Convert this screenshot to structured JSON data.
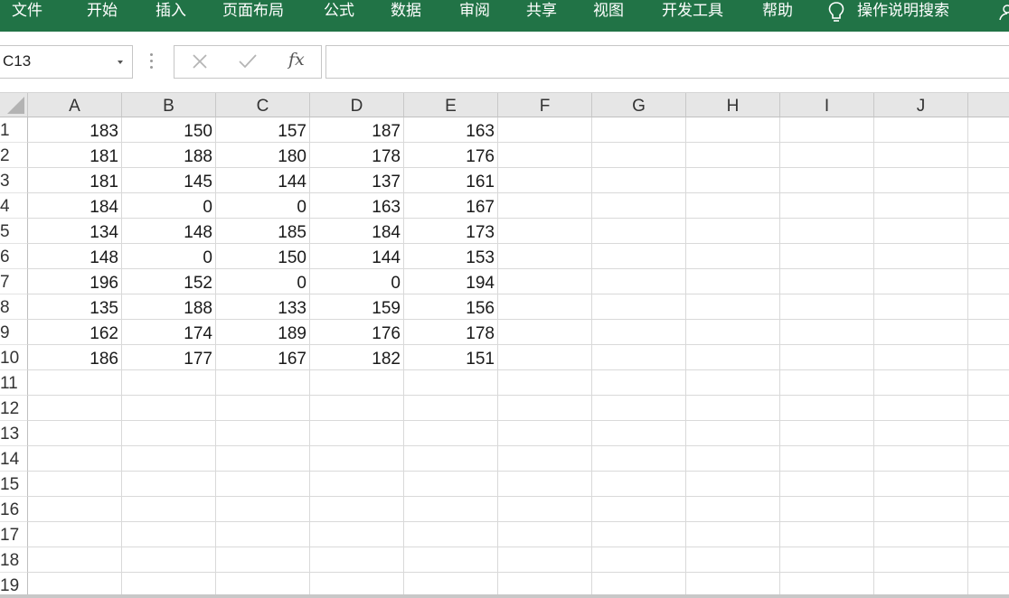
{
  "ribbon": {
    "tabs": [
      "文件",
      "开始",
      "插入",
      "页面布局",
      "公式",
      "数据",
      "审阅",
      "共享",
      "视图",
      "开发工具",
      "帮助"
    ],
    "search_label": "操作说明搜索",
    "icons": [
      "lightbulb-icon",
      "person-icon"
    ]
  },
  "formula_bar": {
    "name_box": "C13",
    "formula": "",
    "icons": [
      "cancel-icon",
      "enter-icon",
      "fx-icon"
    ]
  },
  "sheet": {
    "columns": [
      "A",
      "B",
      "C",
      "D",
      "E",
      "F",
      "G",
      "H",
      "I",
      "J"
    ],
    "rows": [
      "1",
      "2",
      "3",
      "4",
      "5",
      "6",
      "7",
      "8",
      "9",
      "10",
      "11",
      "12",
      "13",
      "14",
      "15",
      "16",
      "17",
      "18",
      "19"
    ],
    "cells": [
      [
        "183",
        "150",
        "157",
        "187",
        "163"
      ],
      [
        "181",
        "188",
        "180",
        "178",
        "176"
      ],
      [
        "181",
        "145",
        "144",
        "137",
        "161"
      ],
      [
        "184",
        "0",
        "0",
        "163",
        "167"
      ],
      [
        "134",
        "148",
        "185",
        "184",
        "173"
      ],
      [
        "148",
        "0",
        "150",
        "144",
        "153"
      ],
      [
        "196",
        "152",
        "0",
        "0",
        "194"
      ],
      [
        "135",
        "188",
        "133",
        "159",
        "156"
      ],
      [
        "162",
        "174",
        "189",
        "176",
        "178"
      ],
      [
        "186",
        "177",
        "167",
        "182",
        "151"
      ]
    ]
  },
  "colors": {
    "ribbon": "#217346",
    "header_bg": "#e6e6e6",
    "gridline": "#d9d9d9"
  }
}
